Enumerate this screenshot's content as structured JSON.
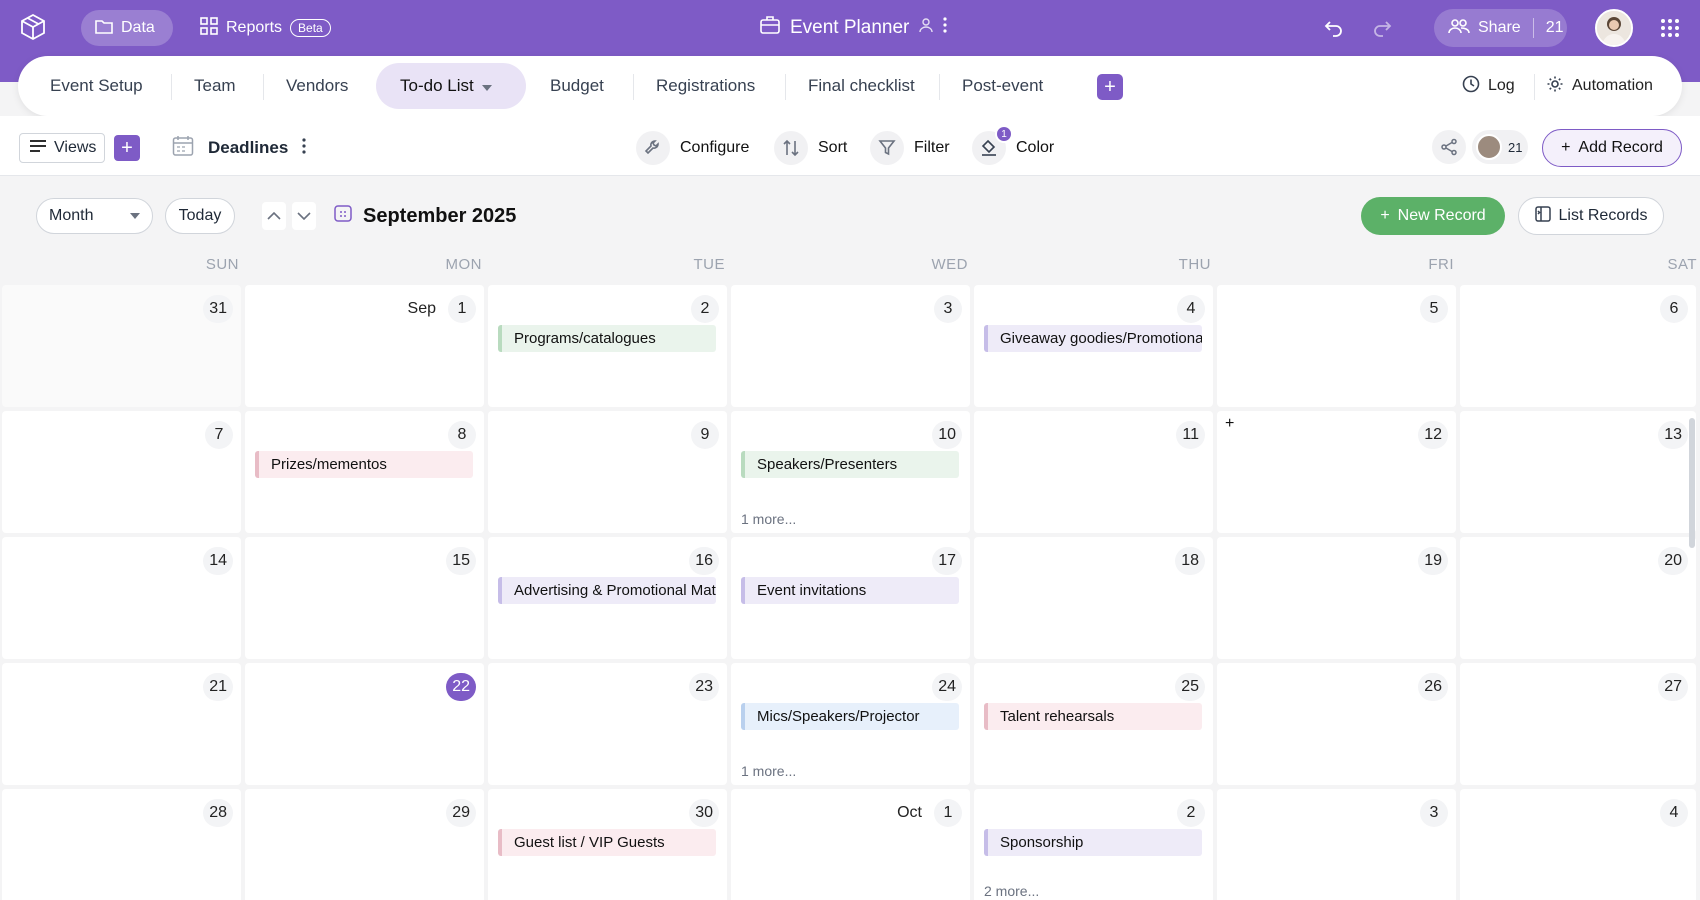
{
  "app": {
    "nav_data": "Data",
    "nav_reports": "Reports",
    "nav_beta": "Beta",
    "title": "Event Planner",
    "share_label": "Share",
    "share_count": "21"
  },
  "tabs": {
    "items": [
      "Event Setup",
      "Team",
      "Vendors",
      "To-do List",
      "Budget",
      "Registrations",
      "Final checklist",
      "Post-event"
    ],
    "active": "To-do List",
    "log": "Log",
    "automation": "Automation"
  },
  "toolbar": {
    "views": "Views",
    "view_name": "Deadlines",
    "configure": "Configure",
    "sort": "Sort",
    "filter": "Filter",
    "color": "Color",
    "color_badge": "1",
    "collab_count": "21",
    "add_record": "Add Record"
  },
  "calendar": {
    "mode": "Month",
    "today": "Today",
    "month_title": "September 2025",
    "new_record": "New Record",
    "list_records": "List Records",
    "weekdays": [
      "SUN",
      "MON",
      "TUE",
      "WED",
      "THU",
      "FRI",
      "SAT"
    ],
    "weeks": [
      [
        {
          "day": "31",
          "other": true
        },
        {
          "day": "1",
          "prefix": "Sep"
        },
        {
          "day": "2",
          "event": "Programs/catalogues",
          "color": "green"
        },
        {
          "day": "3"
        },
        {
          "day": "4",
          "event": "Giveaway goodies/Promotional items",
          "color": "purple"
        },
        {
          "day": "5"
        },
        {
          "day": "6"
        }
      ],
      [
        {
          "day": "7"
        },
        {
          "day": "8",
          "event": "Prizes/mementos",
          "color": "pink"
        },
        {
          "day": "9"
        },
        {
          "day": "10",
          "event": "Speakers/Presenters",
          "color": "green",
          "more": "1 more..."
        },
        {
          "day": "11"
        },
        {
          "day": "12",
          "plus": "+"
        },
        {
          "day": "13"
        }
      ],
      [
        {
          "day": "14"
        },
        {
          "day": "15"
        },
        {
          "day": "16",
          "event": "Advertising & Promotional Materials",
          "color": "purple"
        },
        {
          "day": "17",
          "event": "Event invitations",
          "color": "purple"
        },
        {
          "day": "18"
        },
        {
          "day": "19"
        },
        {
          "day": "20"
        }
      ],
      [
        {
          "day": "21"
        },
        {
          "day": "22",
          "today": true
        },
        {
          "day": "23"
        },
        {
          "day": "24",
          "event": "Mics/Speakers/Projector",
          "color": "blue",
          "more": "1 more..."
        },
        {
          "day": "25",
          "event": "Talent rehearsals",
          "color": "pink"
        },
        {
          "day": "26"
        },
        {
          "day": "27"
        }
      ],
      [
        {
          "day": "28"
        },
        {
          "day": "29"
        },
        {
          "day": "30",
          "event": "Guest list / VIP Guests",
          "color": "pink"
        },
        {
          "day": "1",
          "prefix": "Oct"
        },
        {
          "day": "2",
          "event": "Sponsorship",
          "color": "purple",
          "more": "2 more..."
        },
        {
          "day": "3"
        },
        {
          "day": "4"
        }
      ]
    ]
  },
  "colors": {
    "brand": "#7e5bc6",
    "new_record_green": "#5cb168"
  }
}
